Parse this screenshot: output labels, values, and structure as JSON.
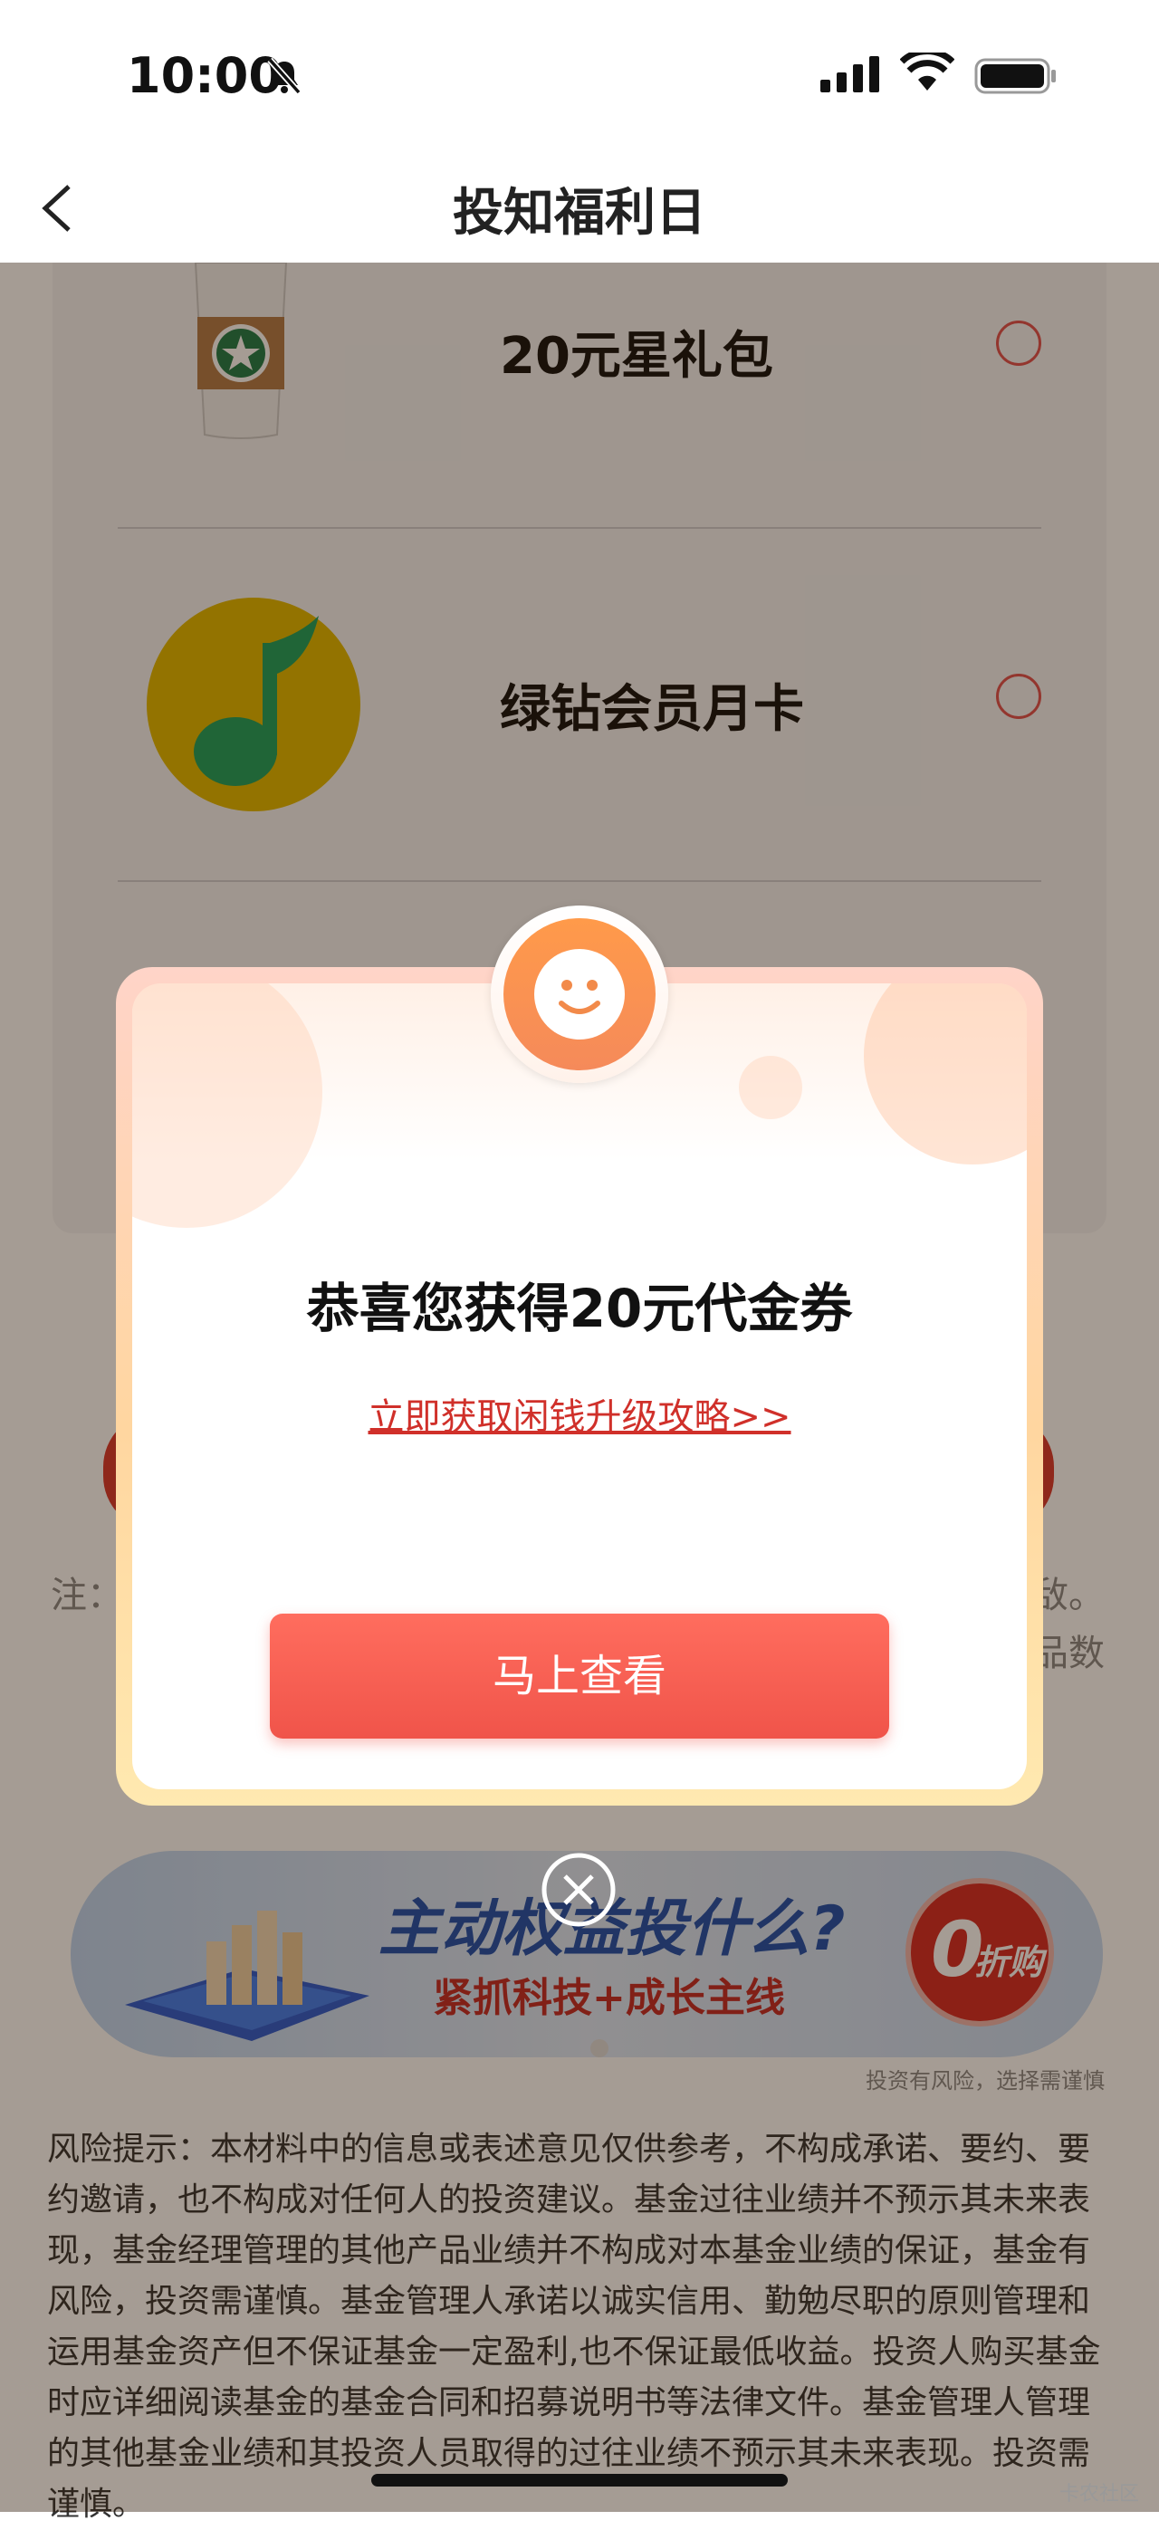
{
  "status_bar": {
    "time": "10:00"
  },
  "nav": {
    "title": "投知福利日"
  },
  "rewards": [
    {
      "title": "20元星礼包",
      "icon": "coffee-cup-icon"
    },
    {
      "title": "绿钻会员月卡",
      "icon": "music-note-icon"
    }
  ],
  "note": {
    "text": "注：广发量有"
  },
  "note_right": {
    "line1": "敌。",
    "line2": "品数"
  },
  "banner": {
    "headline": "主动权益投什么?",
    "subline": "紧抓科技+成长主线",
    "badge_num": "0",
    "badge_text": "折购",
    "tip": "投资有风险，选择需谨慎"
  },
  "risk": {
    "text": "风险提示：本材料中的信息或表述意见仅供参考，不构成承诺、要约、要约邀请，也不构成对任何人的投资建议。基金过往业绩并不预示其未来表现，基金经理管理的其他产品业绩并不构成对本基金业绩的保证，基金有风险，投资需谨慎。基金管理人承诺以诚实信用、勤勉尽职的原则管理和运用基金资产但不保证基金一定盈利,也不保证最低收益。投资人购买基金时应详细阅读基金的基金合同和招募说明书等法律文件。基金管理人管理的其他基金业绩和其投资人员取得的过往业绩不预示其未来表现。投资需谨慎。"
  },
  "modal": {
    "title": "恭喜您获得20元代金券",
    "link": "立即获取闲钱升级攻略>>",
    "button": "马上查看"
  },
  "watermark": "卡农社区",
  "colors": {
    "accent_red": "#f0544a",
    "link_red": "#d0302a",
    "mask": "rgba(40,20,0,0.42)"
  }
}
